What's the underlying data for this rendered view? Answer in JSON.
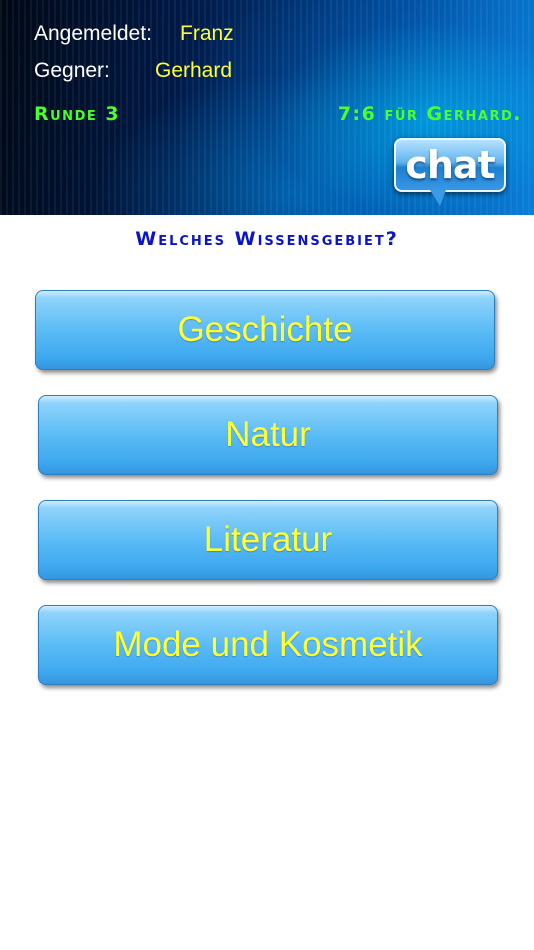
{
  "header": {
    "login_label": "Angemeldet:",
    "login_name": "Franz",
    "opponent_label": "Gegner:",
    "opponent_name": "Gerhard",
    "round": "Runde 3",
    "score": "7:6 für Gerhard.",
    "chat_label": "chat"
  },
  "question": "Welches Wissensgebiet?",
  "categories": [
    {
      "label": "Geschichte"
    },
    {
      "label": "Natur"
    },
    {
      "label": "Literatur"
    },
    {
      "label": "Mode und Kosmetik"
    }
  ],
  "colors": {
    "name_yellow": "#ffff33",
    "status_green": "#4dff2a",
    "question_blue": "#0b14c8",
    "button_blue": "#5bbcf5"
  }
}
